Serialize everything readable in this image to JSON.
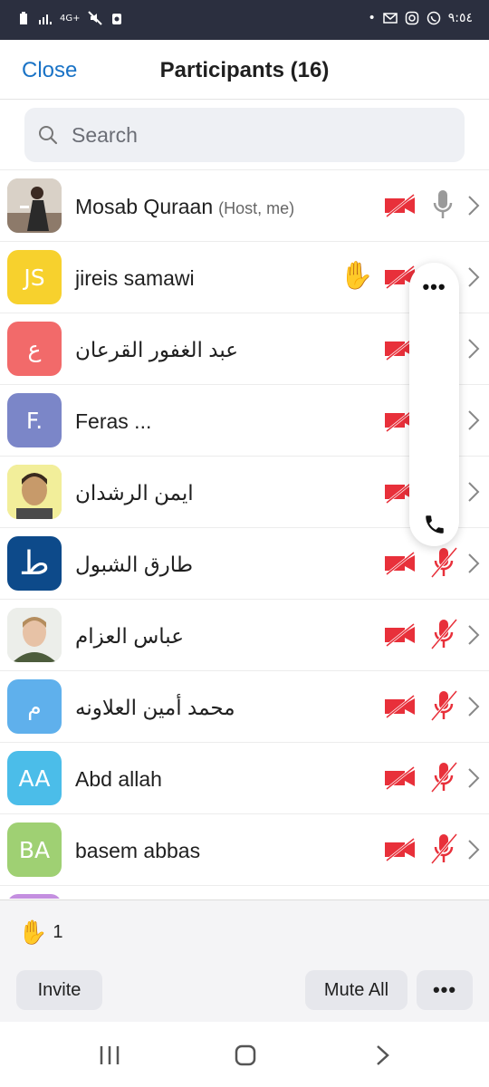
{
  "status_bar": {
    "network": "4G+",
    "time": "٩:٥٤"
  },
  "header": {
    "close_label": "Close",
    "title": "Participants (16)"
  },
  "search": {
    "placeholder": "Search"
  },
  "participants": [
    {
      "name": "Mosab Quraan",
      "tag": "(Host, me)",
      "initials": "",
      "avatar_color": "#b9a99a",
      "photo": true,
      "video_off": true,
      "mic": "on",
      "hand": false
    },
    {
      "name": "jireis samawi",
      "tag": "",
      "initials": "JS",
      "avatar_color": "#f7d12d",
      "photo": false,
      "video_off": true,
      "mic": "on",
      "hand": true
    },
    {
      "name": "عبد الغفور القرعان",
      "tag": "",
      "initials": "ع",
      "avatar_color": "#f26a6a",
      "photo": false,
      "video_off": true,
      "mic": "muted",
      "hand": false
    },
    {
      "name": "Feras ...",
      "tag": "",
      "initials": "F.",
      "avatar_color": "#7b86c8",
      "photo": false,
      "video_off": true,
      "mic": "muted",
      "hand": false
    },
    {
      "name": "ايمن الرشدان",
      "tag": "",
      "initials": "",
      "avatar_color": "#c9b642",
      "photo": true,
      "video_off": true,
      "mic": "muted",
      "hand": false
    },
    {
      "name": "طارق الشبول",
      "tag": "",
      "initials": "ط",
      "avatar_color": "#0d4a8a",
      "photo": false,
      "video_off": true,
      "mic": "muted",
      "hand": false
    },
    {
      "name": "عباس العزام",
      "tag": "",
      "initials": "",
      "avatar_color": "#6e7b5a",
      "photo": true,
      "video_off": true,
      "mic": "muted",
      "hand": false
    },
    {
      "name": "محمد أمين العلاونه",
      "tag": "",
      "initials": "م",
      "avatar_color": "#5fb0ec",
      "photo": false,
      "video_off": true,
      "mic": "muted",
      "hand": false
    },
    {
      "name": "Abd allah",
      "tag": "",
      "initials": "AA",
      "avatar_color": "#4bbde9",
      "photo": false,
      "video_off": true,
      "mic": "muted",
      "hand": false
    },
    {
      "name": "basem abbas",
      "tag": "",
      "initials": "BA",
      "avatar_color": "#9fd073",
      "photo": false,
      "video_off": true,
      "mic": "muted",
      "hand": false
    },
    {
      "name": "",
      "tag": "",
      "initials": "",
      "avatar_color": "#c48fe0",
      "photo": false,
      "video_off": true,
      "mic": "muted",
      "hand": false
    }
  ],
  "footer": {
    "raised_hands_count": "1",
    "invite_label": "Invite",
    "mute_all_label": "Mute All",
    "more_label": "•••"
  },
  "float_panel": {
    "more_label": "•••"
  },
  "colors": {
    "accent": "#1a73c6",
    "muted_red": "#e8303a",
    "status_bar": "#2b2f3f"
  }
}
